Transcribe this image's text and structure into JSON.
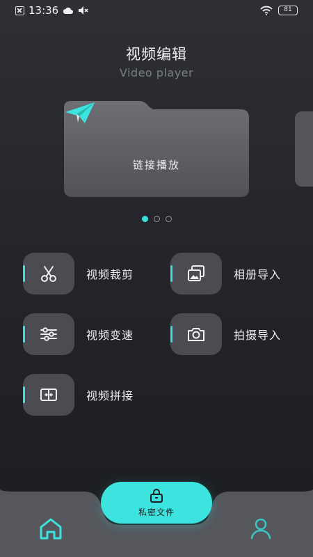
{
  "status_bar": {
    "time": "13:36",
    "battery": "81",
    "icons": [
      "notification-x-icon",
      "cloud-icon",
      "speaker-mute-icon",
      "wifi-icon",
      "battery-icon"
    ]
  },
  "header": {
    "title": "视频编辑",
    "subtitle": "Video player"
  },
  "carousel": {
    "cards": [
      {
        "label": "链接播放",
        "icon": "paper-plane-icon"
      }
    ],
    "page_count": 3,
    "active_page": 0
  },
  "features": [
    {
      "label": "视频裁剪",
      "icon": "scissors-icon"
    },
    {
      "label": "相册导入",
      "icon": "photos-icon"
    },
    {
      "label": "视频变速",
      "icon": "sliders-icon"
    },
    {
      "label": "拍摄导入",
      "icon": "camera-icon"
    },
    {
      "label": "视频拼接",
      "icon": "merge-icon"
    }
  ],
  "bottom_nav": {
    "private_label": "私密文件",
    "items": [
      "home-icon",
      "profile-icon"
    ]
  },
  "colors": {
    "accent": "#3de3de",
    "tile": "#4a4c51",
    "background": "#24262b"
  }
}
